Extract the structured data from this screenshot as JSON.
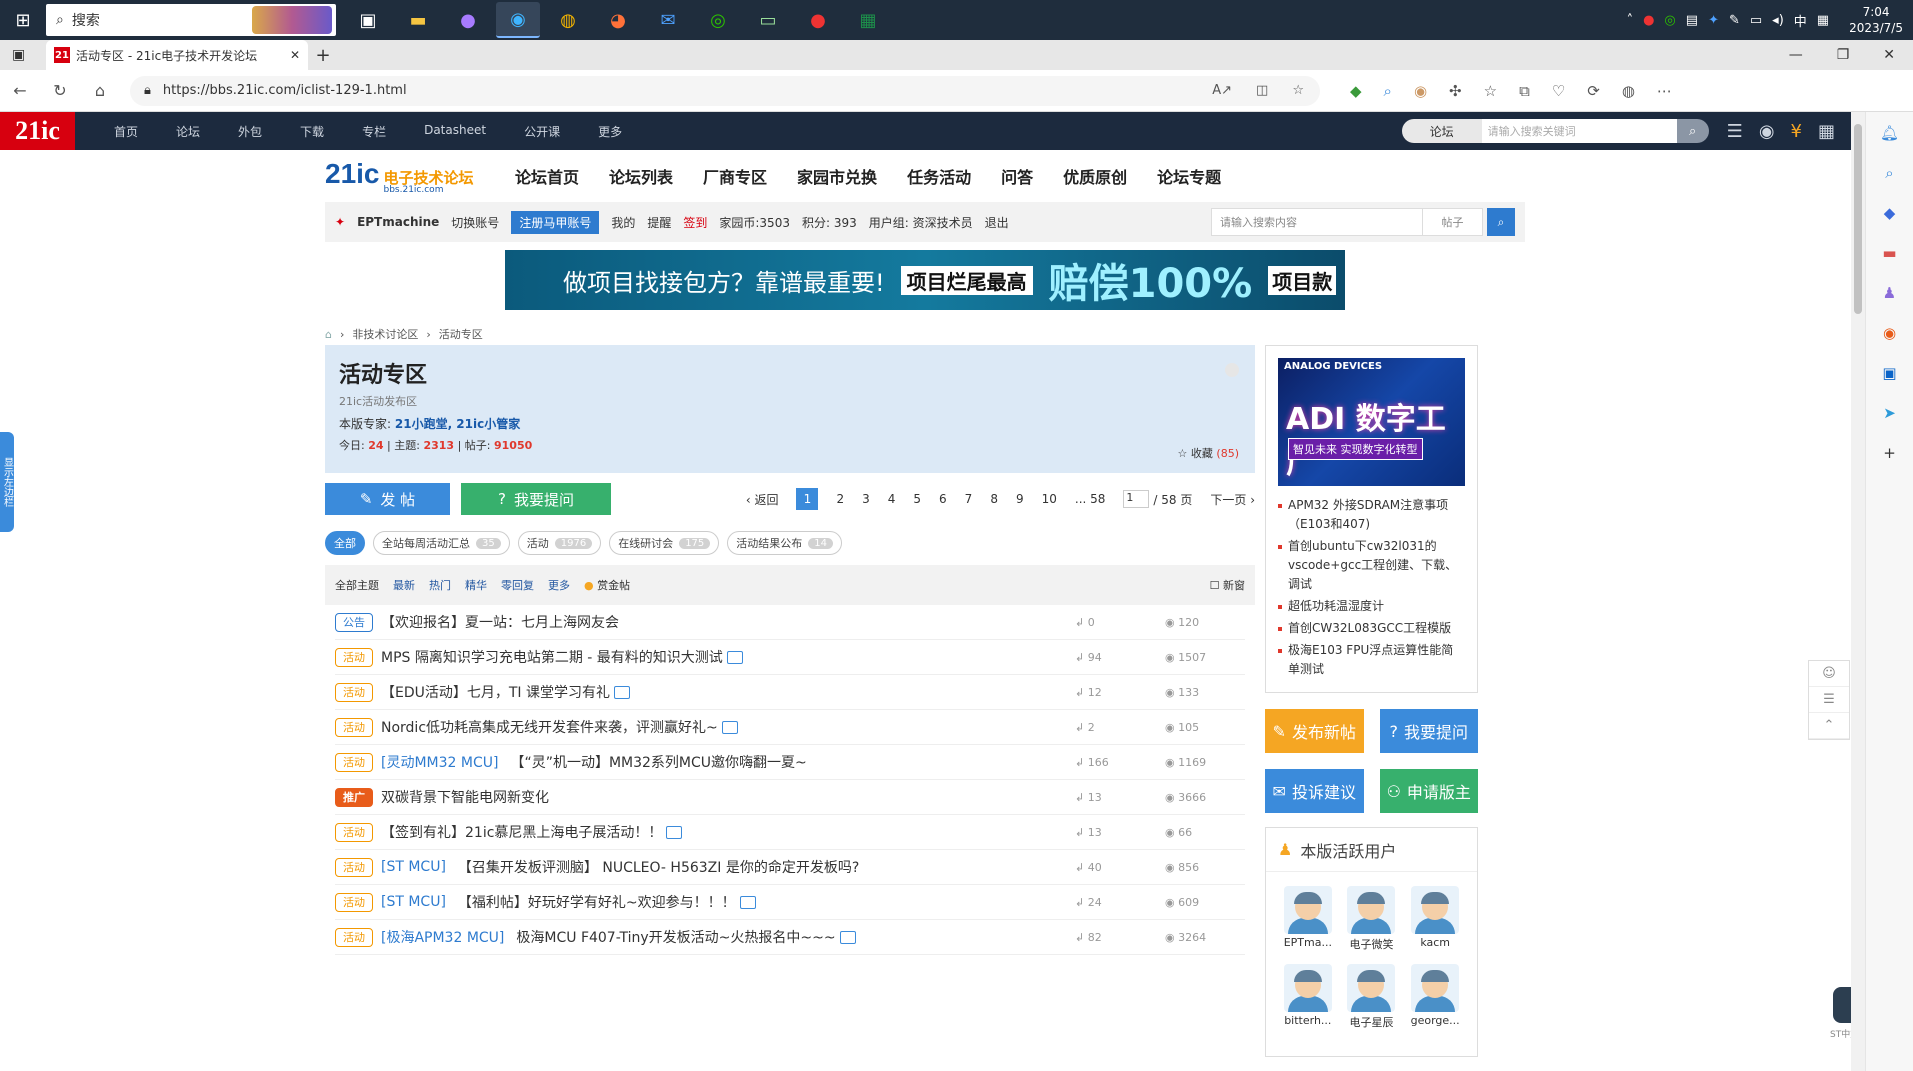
{
  "taskbar": {
    "search_placeholder": "搜索",
    "time": "7:04",
    "date": "2023/7/5",
    "ime": "中"
  },
  "browser": {
    "tab_title": "活动专区 - 21ic电子技术开发论坛",
    "tab_favicon": "21",
    "url": "https://bbs.21ic.com/iclist-129-1.html"
  },
  "site_nav": {
    "logo": "21ic",
    "items": [
      "首页",
      "论坛",
      "外包",
      "下载",
      "专栏",
      "Datasheet",
      "公开课",
      "更多"
    ],
    "search_scope": "论坛",
    "search_placeholder": "请输入搜索关键词"
  },
  "forum_header": {
    "logo_big": "21ic",
    "logo_cn": "电子技术论坛",
    "logo_url": "bbs.21ic.com",
    "nav": [
      "论坛首页",
      "论坛列表",
      "厂商专区",
      "家园市兑换",
      "任务活动",
      "问答",
      "优质原创",
      "论坛专题"
    ]
  },
  "userbar": {
    "username": "EPTmachine",
    "switch": "切换账号",
    "register": "注册马甲账号",
    "mine": "我的",
    "remind": "提醒",
    "signin": "签到",
    "coins": "家园币:3503",
    "points": "积分: 393",
    "group": "用户组: 资深技术员",
    "logout": "退出",
    "search_placeholder": "请输入搜索内容",
    "search_scope": "帖子"
  },
  "banner": {
    "t1": "做项目找接包方？靠谱最重要!",
    "t2": "项目烂尾最高",
    "t3": "赔偿100%",
    "t4": "项目款"
  },
  "breadcrumb": [
    "非技术讨论区",
    "活动专区"
  ],
  "forum_info": {
    "title": "活动专区",
    "desc": "21ic活动发布区",
    "mods_label": "本版专家:",
    "mods": "21小跑堂, 21ic小管家",
    "today_label": "今日:",
    "today": "24",
    "topics_label": "主题:",
    "topics": "2313",
    "posts_label": "帖子:",
    "posts": "91050",
    "fav_label": "收藏",
    "fav_count": "(85)"
  },
  "actions": {
    "post": "发 帖",
    "ask": "我要提问"
  },
  "pager": {
    "prev": "返回",
    "pages": [
      "1",
      "2",
      "3",
      "4",
      "5",
      "6",
      "7",
      "8",
      "9",
      "10"
    ],
    "last": "... 58",
    "input": "1",
    "total": "/ 58 页",
    "next": "下一页"
  },
  "chips": [
    {
      "label": "全部",
      "count": ""
    },
    {
      "label": "全站每周活动汇总",
      "count": "35"
    },
    {
      "label": "活动",
      "count": "1976"
    },
    {
      "label": "在线研讨会",
      "count": "175"
    },
    {
      "label": "活动结果公布",
      "count": "14"
    }
  ],
  "filters": {
    "all": "全部主题",
    "items": [
      "最新",
      "热门",
      "精华",
      "零回复",
      "更多"
    ],
    "bounty": "赏金帖",
    "new_window": "新窗"
  },
  "threads": [
    {
      "tag": "公告",
      "prefix": "",
      "title": "【欢迎报名】夏一站：七月上海网友会",
      "img": false,
      "replies": "0",
      "views": "120"
    },
    {
      "tag": "活动",
      "prefix": "",
      "title": "MPS 隔离知识学习充电站第二期 - 最有料的知识大测试",
      "img": true,
      "replies": "94",
      "views": "1507"
    },
    {
      "tag": "活动",
      "prefix": "",
      "title": "【EDU活动】七月，TI 课堂学习有礼",
      "img": true,
      "replies": "12",
      "views": "133"
    },
    {
      "tag": "活动",
      "prefix": "",
      "title": "Nordic低功耗高集成无线开发套件来袭，评测赢好礼~",
      "img": true,
      "replies": "2",
      "views": "105"
    },
    {
      "tag": "活动",
      "prefix": "[灵动MM32 MCU]",
      "title": "【“灵”机一动】MM32系列MCU邀你嗨翻一夏~",
      "img": false,
      "replies": "166",
      "views": "1169"
    },
    {
      "tag": "推广",
      "prefix": "",
      "title": "双碳背景下智能电网新变化",
      "img": false,
      "replies": "13",
      "views": "3666"
    },
    {
      "tag": "活动",
      "prefix": "",
      "title": "【签到有礼】21ic慕尼黑上海电子展活动！！",
      "img": true,
      "replies": "13",
      "views": "66"
    },
    {
      "tag": "活动",
      "prefix": "[ST MCU]",
      "title": "【召集开发板评测脑】 NUCLEO- H563ZI 是你的命定开发板吗?",
      "img": false,
      "replies": "40",
      "views": "856"
    },
    {
      "tag": "活动",
      "prefix": "[ST MCU]",
      "title": "【福利帖】好玩好学有好礼~欢迎参与！！！",
      "img": true,
      "replies": "24",
      "views": "609"
    },
    {
      "tag": "活动",
      "prefix": "[极海APM32 MCU]",
      "title": "极海MCU F407-Tiny开发板活动~火热报名中~~~",
      "img": true,
      "replies": "82",
      "views": "3264"
    }
  ],
  "sidebar_ad": {
    "brand": "ANALOG DEVICES",
    "title": "ADI 数字工厂",
    "subtitle": "智见未来 实现数字化转型",
    "links": [
      "APM32 外接SDRAM注意事项（E103和407)",
      "首创ubuntu下cw32l031的vscode+gcc工程创建、下载、调试",
      "超低功耗温湿度计",
      "首创CW32L083GCC工程模版",
      "极海E103 FPU浮点运算性能简单测试"
    ]
  },
  "side_buttons": [
    "发布新帖",
    "我要提问",
    "投诉建议",
    "申请版主"
  ],
  "active_users": {
    "title": "本版活跃用户",
    "users": [
      "EPTma...",
      "电子微笑",
      "kacm",
      "bitterh...",
      "电子星辰",
      "george..."
    ]
  },
  "sidetab_label": "显示左边栏",
  "chat_label": "ST中文论坛"
}
